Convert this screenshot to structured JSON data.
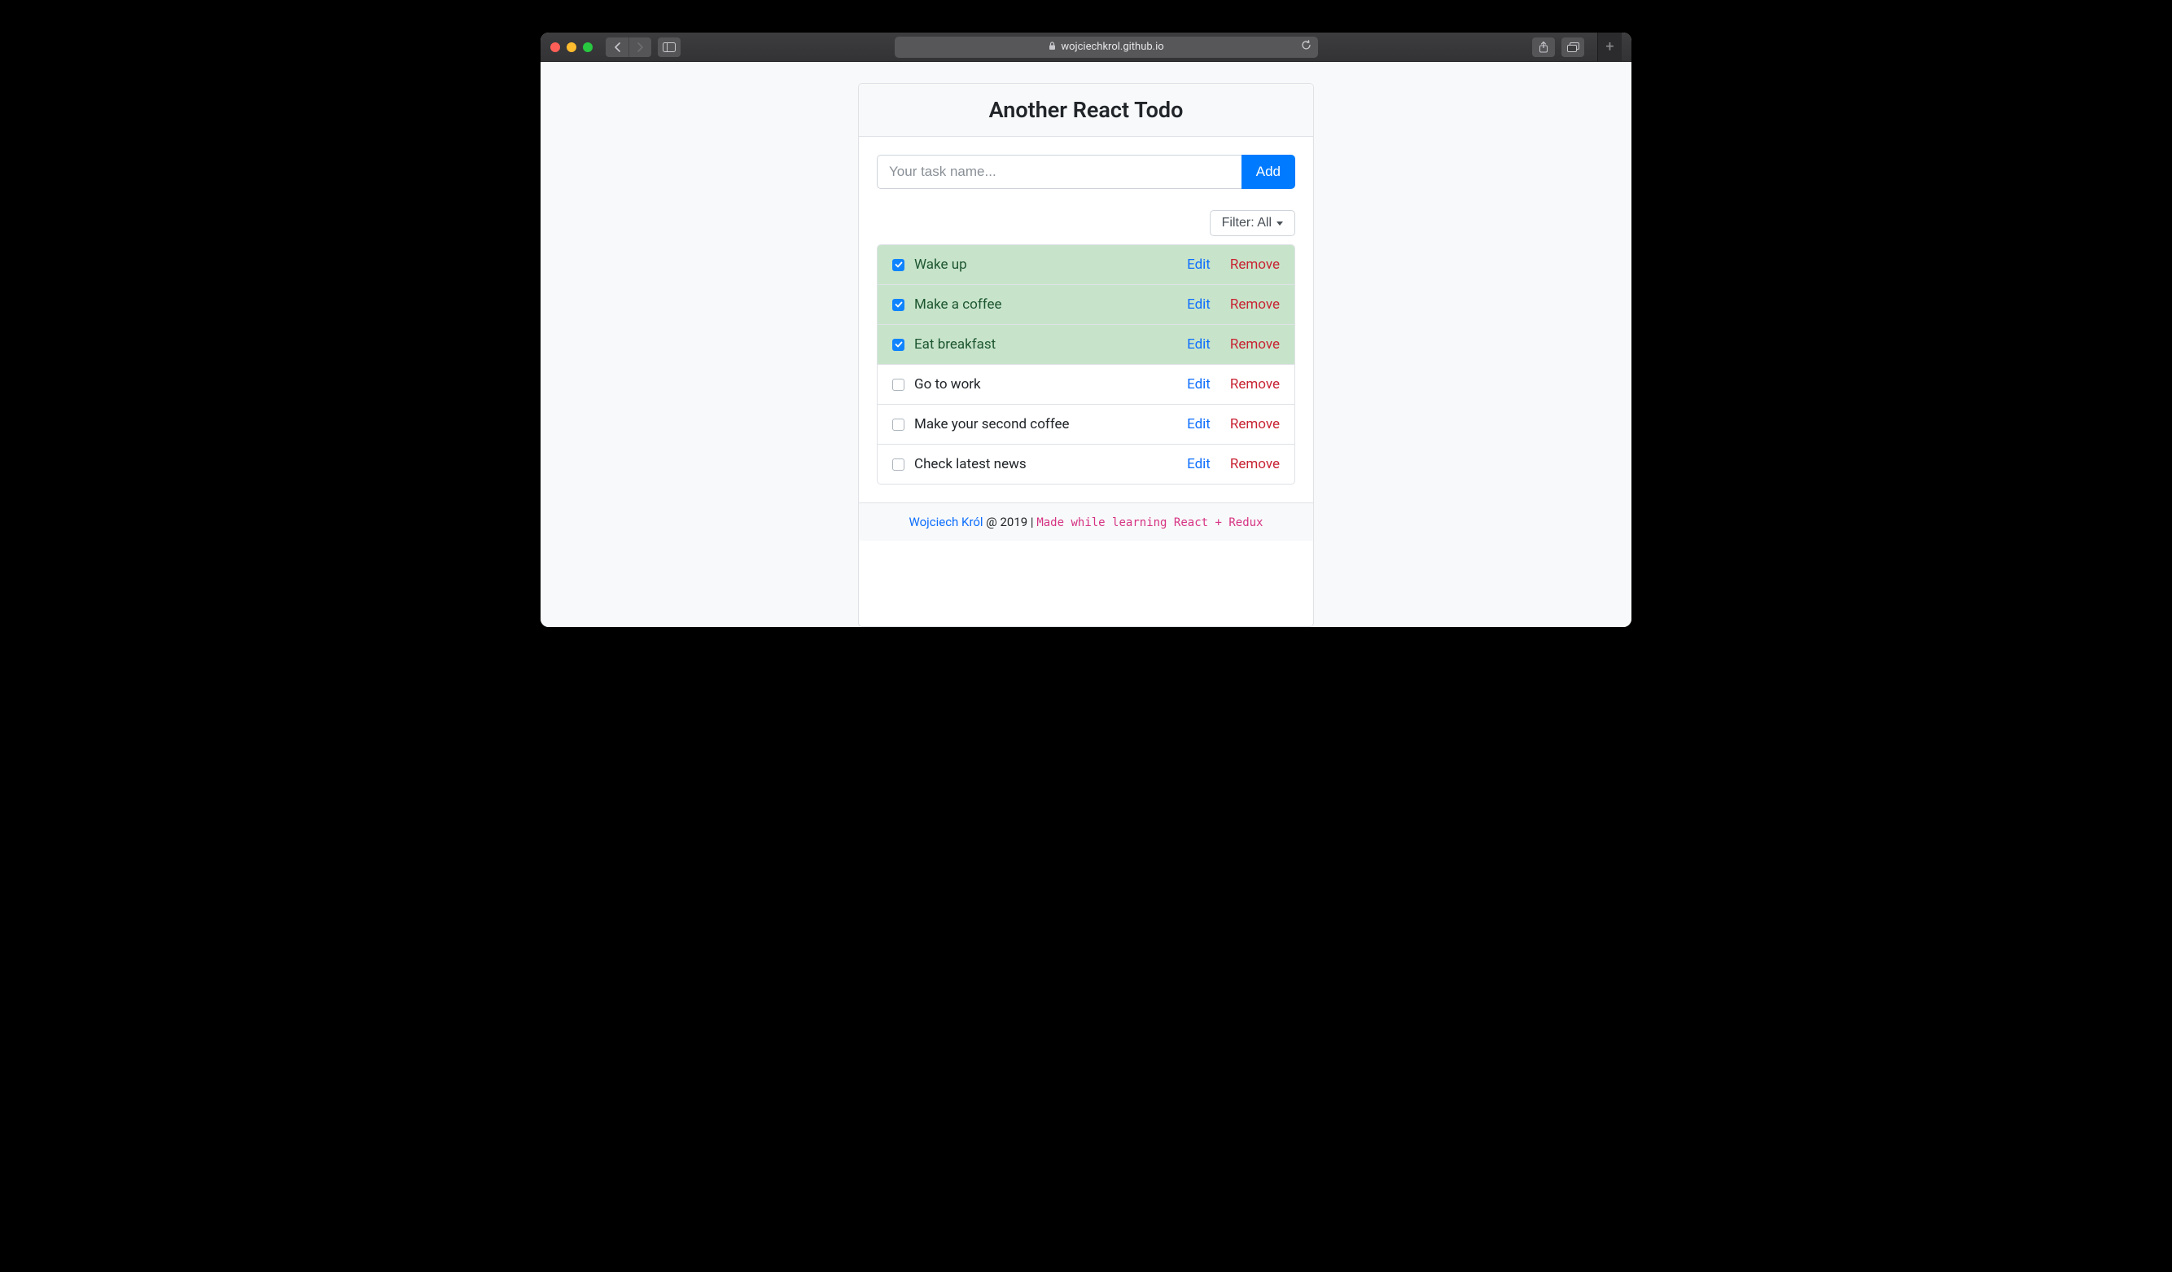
{
  "browser": {
    "url_display": "wojciechkrol.github.io"
  },
  "app": {
    "title": "Another React Todo",
    "input_placeholder": "Your task name...",
    "add_label": "Add",
    "filter_label": "Filter: All",
    "edit_label": "Edit",
    "remove_label": "Remove",
    "todos": [
      {
        "text": "Wake up",
        "done": true
      },
      {
        "text": "Make a coffee",
        "done": true
      },
      {
        "text": "Eat breakfast",
        "done": true
      },
      {
        "text": "Go to work",
        "done": false
      },
      {
        "text": "Make your second coffee",
        "done": false
      },
      {
        "text": "Check latest news",
        "done": false
      }
    ],
    "footer": {
      "author": "Wojciech Król",
      "year_text": " @ 2019 | ",
      "note": "Made while learning React + Redux"
    }
  }
}
